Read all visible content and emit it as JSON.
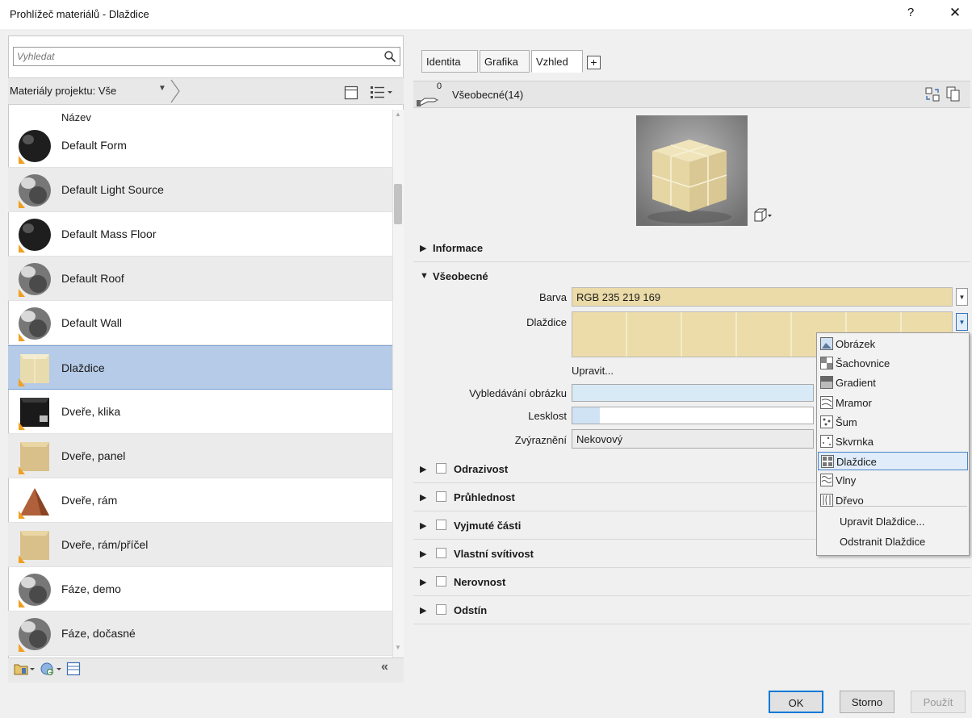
{
  "window": {
    "title": "Prohlížeč materiálů - Dlaždice",
    "help": "?",
    "close": "✕"
  },
  "search": {
    "placeholder": "Vyhledat",
    "value": ""
  },
  "filter": {
    "label": "Materiály projektu: Vše"
  },
  "list": {
    "column_header": "Název",
    "selected": "Dlaždice",
    "items": [
      {
        "label": "Default Form",
        "thumb": "black-sphere"
      },
      {
        "label": "Default Light Source",
        "thumb": "grey-sphere"
      },
      {
        "label": "Default Mass Floor",
        "thumb": "black-sphere"
      },
      {
        "label": "Default Roof",
        "thumb": "grey-sphere"
      },
      {
        "label": "Default Wall",
        "thumb": "grey-sphere"
      },
      {
        "label": "Dlaždice",
        "thumb": "cream-cube"
      },
      {
        "label": "Dveře, klika",
        "thumb": "black-cube"
      },
      {
        "label": "Dveře, panel",
        "thumb": "wood-cube"
      },
      {
        "label": "Dveře, rám",
        "thumb": "brown-cube"
      },
      {
        "label": "Dveře, rám/příčel",
        "thumb": "wood-cube"
      },
      {
        "label": "Fáze, demo",
        "thumb": "grey-sphere"
      },
      {
        "label": "Fáze, dočasné",
        "thumb": "grey-sphere"
      }
    ]
  },
  "tabs": [
    {
      "label": "Identita",
      "active": false
    },
    {
      "label": "Grafika",
      "active": false
    },
    {
      "label": "Vzhled",
      "active": true
    }
  ],
  "tab_add": "+",
  "asset": {
    "count": "0",
    "name": "Všeobecné(14)"
  },
  "sections": {
    "info": "Informace",
    "general": "Všeobecné",
    "collapsed": [
      "Odrazivost",
      "Průhlednost",
      "Vyjmuté části",
      "Vlastní svítivost",
      "Nerovnost",
      "Odstín"
    ]
  },
  "props": {
    "barva_label": "Barva",
    "barva_value": "RGB 235 219 169",
    "barva_color": "#ebdba9",
    "dlazdice_label": "Dlaždice",
    "edit_link": "Upravit...",
    "fade_label": "Vybledávání obrázku",
    "gloss_label": "Lesklost",
    "highlight_label": "Zvýraznění",
    "highlight_value": "Nekovový"
  },
  "menu": {
    "items": [
      {
        "label": "Obrázek",
        "icon": "image-icon"
      },
      {
        "label": "Šachovnice",
        "icon": "checker-icon"
      },
      {
        "label": "Gradient",
        "icon": "gradient-icon"
      },
      {
        "label": "Mramor",
        "icon": "marble-icon"
      },
      {
        "label": "Šum",
        "icon": "noise-icon"
      },
      {
        "label": "Skvrnka",
        "icon": "speckle-icon"
      },
      {
        "label": "Dlaždice",
        "icon": "tiles-icon"
      },
      {
        "label": "Vlny",
        "icon": "waves-icon"
      },
      {
        "label": "Dřevo",
        "icon": "wood-icon"
      }
    ],
    "highlighted": "Dlaždice",
    "actions": [
      "Upravit Dlaždice...",
      "Odstranit Dlaždice"
    ]
  },
  "buttons": {
    "ok": "OK",
    "cancel": "Storno",
    "apply": "Použít"
  },
  "colors": {
    "selection": "#b5cbe7",
    "accent": "#0078d7",
    "tile": "#ebdba9"
  }
}
